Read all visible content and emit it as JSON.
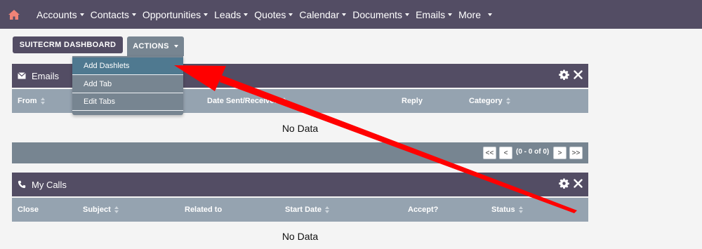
{
  "nav": {
    "items": [
      {
        "label": "Accounts"
      },
      {
        "label": "Contacts"
      },
      {
        "label": "Opportunities"
      },
      {
        "label": "Leads"
      },
      {
        "label": "Quotes"
      },
      {
        "label": "Calendar"
      },
      {
        "label": "Documents"
      },
      {
        "label": "Emails"
      },
      {
        "label": "More"
      }
    ]
  },
  "toolbar": {
    "dashboard_label": "SUITECRM DASHBOARD",
    "actions_label": "ACTIONS"
  },
  "actions_menu": {
    "items": [
      {
        "label": "Add Dashlets",
        "active": true
      },
      {
        "label": "Add Tab"
      },
      {
        "label": "Edit Tabs"
      }
    ]
  },
  "emails_dashlet": {
    "title": "Emails",
    "columns": [
      {
        "label": "From",
        "sortable": true
      },
      {
        "label": "Date Sent/Received",
        "sortable": true
      },
      {
        "label": "Reply",
        "sortable": false
      },
      {
        "label": "Category",
        "sortable": true
      }
    ],
    "empty_text": "No Data",
    "pager": {
      "first": "<<",
      "prev": "<",
      "info": "(0 - 0 of 0)",
      "next": ">",
      "last": ">>"
    }
  },
  "calls_dashlet": {
    "title": "My Calls",
    "columns": [
      {
        "label": "Close",
        "sortable": false
      },
      {
        "label": "Subject",
        "sortable": true
      },
      {
        "label": "Related to",
        "sortable": false
      },
      {
        "label": "Start Date",
        "sortable": true
      },
      {
        "label": "Accept?",
        "sortable": false
      },
      {
        "label": "Status",
        "sortable": true
      }
    ],
    "empty_text": "No Data"
  },
  "colors": {
    "nav_bg": "#534d64",
    "column_bar": "#95a3b0",
    "pager_bar": "#778591",
    "menu_active": "#4f7990",
    "home_icon": "#f08377",
    "annotation_arrow": "#ff0000"
  },
  "icons": {
    "home": "home-icon",
    "emails": "envelope-icon",
    "calls": "phone-icon",
    "settings": "gear-icon",
    "close": "close-icon"
  }
}
